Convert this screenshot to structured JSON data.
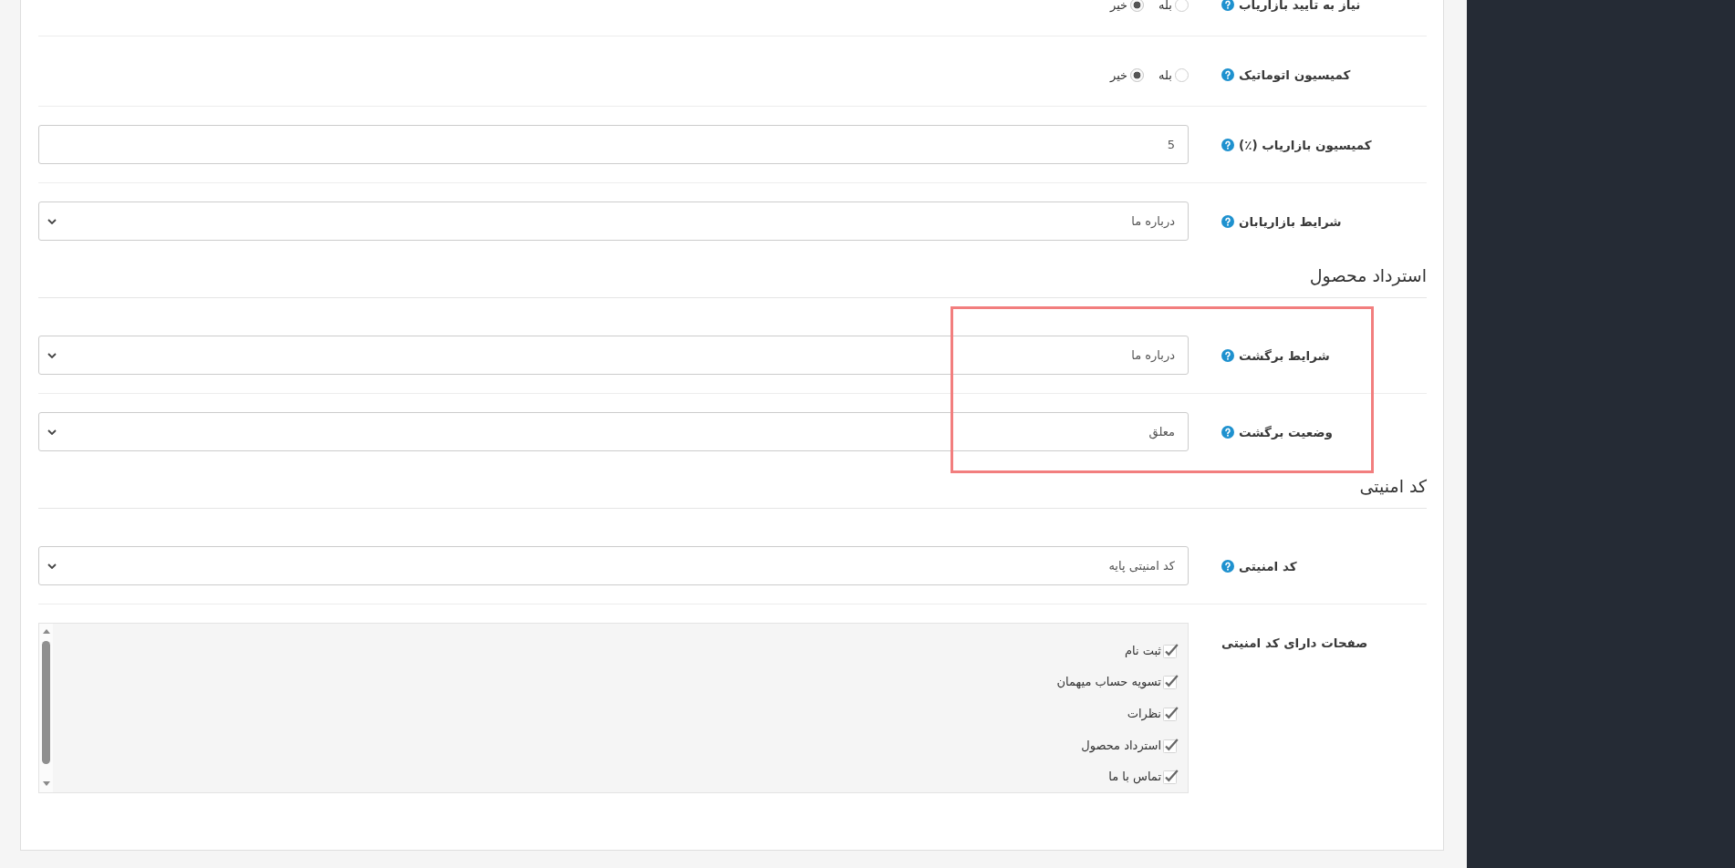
{
  "form": {
    "fields": [
      {
        "kind": "radio",
        "label": "نیاز به تایید بازاریاب",
        "help": true,
        "options": [
          {
            "label": "بله",
            "selected": false
          },
          {
            "label": "خیر",
            "selected": true
          }
        ]
      },
      {
        "kind": "radio",
        "label": "کمیسیون اتوماتیک",
        "help": true,
        "options": [
          {
            "label": "بله",
            "selected": false
          },
          {
            "label": "خیر",
            "selected": true
          }
        ]
      },
      {
        "kind": "text",
        "label": "کمیسیون بازاریاب (٪)",
        "help": true,
        "value": "5"
      },
      {
        "kind": "select",
        "label": "شرایط بازاریابان",
        "help": true,
        "value": "درباره ما"
      }
    ]
  },
  "sections": [
    {
      "title": "استرداد محصول",
      "highlighted": true,
      "fields": [
        {
          "kind": "select",
          "label": "شرایط برگشت",
          "help": true,
          "value": "درباره ما"
        },
        {
          "kind": "select",
          "label": "وضعیت برگشت",
          "help": true,
          "value": "معلق"
        }
      ]
    },
    {
      "title": "کد امنیتی",
      "highlighted": false,
      "fields": [
        {
          "kind": "select",
          "label": "کد امنیتی",
          "help": true,
          "value": "کد امنیتی پایه"
        },
        {
          "kind": "checklist",
          "label": "صفحات دارای کد امنیتی",
          "help": false,
          "items": [
            {
              "label": "ثبت نام",
              "checked": true
            },
            {
              "label": "تسویه حساب میهمان",
              "checked": true
            },
            {
              "label": "نظرات",
              "checked": true
            },
            {
              "label": "استرداد محصول",
              "checked": true
            },
            {
              "label": "تماس با ما",
              "checked": true
            }
          ]
        }
      ]
    }
  ]
}
